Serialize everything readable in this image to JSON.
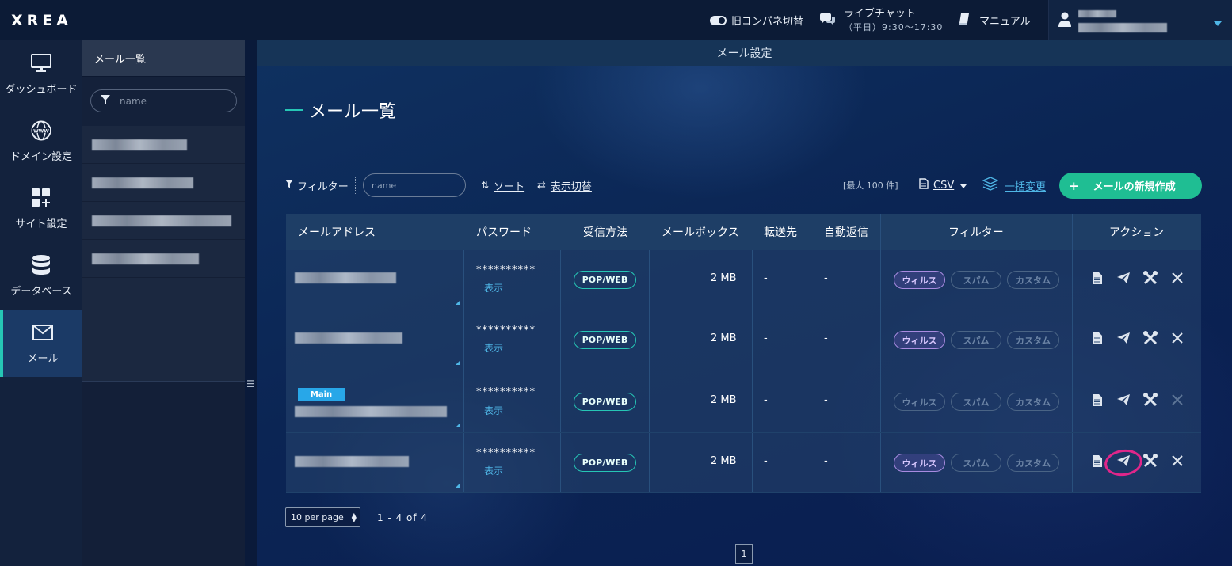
{
  "app": {
    "logo": "XREA"
  },
  "topbar": {
    "old_panel_label": "旧コンパネ切替",
    "chat_label": "ライブチャット",
    "chat_hours": "（平日）9:30〜17:30",
    "manual_label": "マニュアル"
  },
  "nav": {
    "items": [
      {
        "label": "ダッシュボード",
        "icon": "monitor-icon"
      },
      {
        "label": "ドメイン設定",
        "icon": "globe-icon"
      },
      {
        "label": "サイト設定",
        "icon": "grid-plus-icon"
      },
      {
        "label": "データベース",
        "icon": "database-icon"
      },
      {
        "label": "メール",
        "icon": "mail-icon",
        "active": true
      }
    ]
  },
  "subpanel": {
    "title": "メール一覧",
    "filter_placeholder": "name"
  },
  "main": {
    "header": "メール設定",
    "title": "メール一覧",
    "toolbar": {
      "filter_label": "フィルター",
      "filter_placeholder": "name",
      "sort_label": "ソート",
      "display_toggle_label": "表示切替",
      "max_note": "[最大 100 件]",
      "csv_label": "CSV",
      "bulk_label": "一括変更",
      "new_button": "メールの新規作成"
    },
    "table": {
      "headers": [
        "メールアドレス",
        "パスワード",
        "受信方法",
        "メールボックス",
        "転送先",
        "自動返信",
        "フィルター",
        "アクション"
      ],
      "rows": [
        {
          "password": "**********",
          "show": "表示",
          "method": "POP/WEB",
          "mailbox": "2 MB",
          "forward": "-",
          "autoreply": "-",
          "virus": "ウィルス",
          "spam": "スパム",
          "custom": "カスタム",
          "virus_on": true,
          "delete_enabled": true
        },
        {
          "password": "**********",
          "show": "表示",
          "method": "POP/WEB",
          "mailbox": "2 MB",
          "forward": "-",
          "autoreply": "-",
          "virus": "ウィルス",
          "spam": "スパム",
          "custom": "カスタム",
          "virus_on": true,
          "delete_enabled": true
        },
        {
          "badge": "Main",
          "password": "**********",
          "show": "表示",
          "method": "POP/WEB",
          "mailbox": "2 MB",
          "forward": "-",
          "autoreply": "-",
          "virus": "ウィルス",
          "spam": "スパム",
          "custom": "カスタム",
          "virus_on": false,
          "delete_enabled": false
        },
        {
          "password": "**********",
          "show": "表示",
          "method": "POP/WEB",
          "mailbox": "2 MB",
          "forward": "-",
          "autoreply": "-",
          "virus": "ウィルス",
          "spam": "スパム",
          "custom": "カスタム",
          "virus_on": true,
          "delete_enabled": true
        }
      ]
    },
    "pager": {
      "per_page": "10 per page",
      "count": "1 - 4 of 4",
      "page": "1"
    }
  },
  "colors": {
    "accent": "#26c6b5",
    "new_button": "#1fbe93",
    "virus_pill": "#a88be0",
    "annotation": "#e0268a"
  }
}
